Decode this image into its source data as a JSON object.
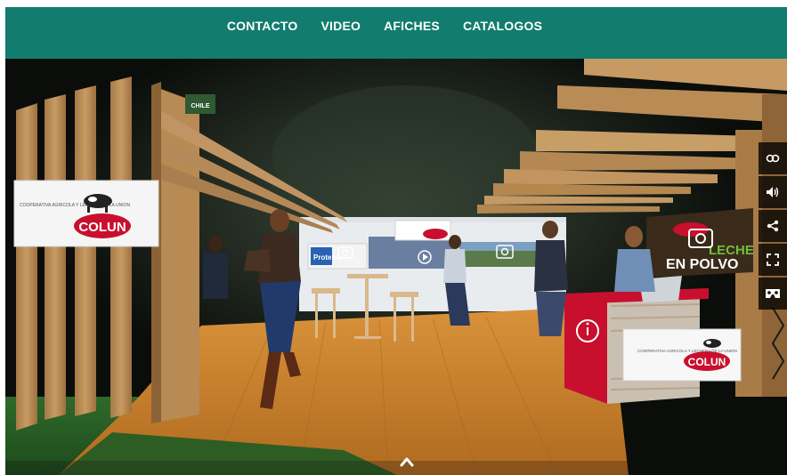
{
  "nav": {
    "items": [
      "CONTACTO",
      "VIDEO",
      "AFICHES",
      "CATALOGOS"
    ]
  },
  "brand": {
    "name": "COLUN",
    "left_sign_tagline": "COOPERATIVA AGRICOLA Y LECHERA DE LA UNION",
    "counter_sign_tagline": "COOPERATIVA AGRICOLA Y LECHERA DE LA UNION",
    "right_sign_line1": "LECHE",
    "right_sign_line2": "EN POLVO",
    "poster_label": "Proteína",
    "top_sign_label": "CHILE"
  },
  "toolbar": {
    "icons": [
      "vr-glasses-icon",
      "volume-icon",
      "share-icon",
      "fullscreen-icon",
      "cardboard-icon"
    ]
  },
  "colors": {
    "navbar": "#127c6f",
    "brand_red": "#c8102e",
    "wood": "#b98a52",
    "floor": "#c8832e"
  }
}
